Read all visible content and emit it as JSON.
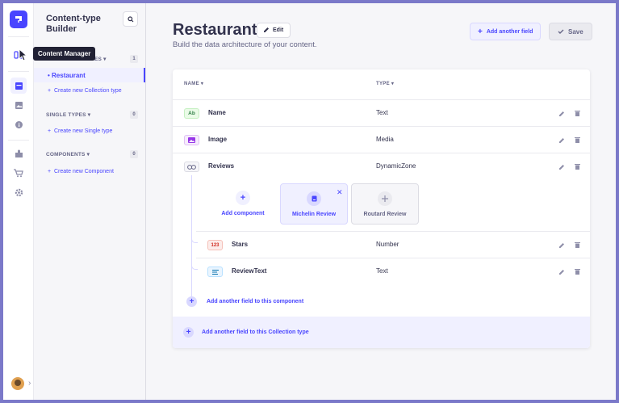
{
  "app": {
    "brand_color": "#4945ff",
    "tooltip": "Content Manager"
  },
  "sidebar": {
    "title": "Content-type Builder",
    "search_icon": "search-icon",
    "sections": [
      {
        "heading": "COLLECTION TYPES",
        "visible_heading_fragment": "ES",
        "count": "1",
        "active_item": "Restaurant",
        "create_link": "Create new Collection type"
      },
      {
        "heading": "SINGLE TYPES",
        "count": "0",
        "create_link": "Create new Single type"
      },
      {
        "heading": "COMPONENTS",
        "count": "0",
        "create_link": "Create new Component"
      }
    ]
  },
  "header": {
    "title": "Restaurant",
    "edit_label": "Edit",
    "subtitle": "Build the data architecture of your content.",
    "add_field_label": "Add another field",
    "save_label": "Save"
  },
  "table": {
    "col_name": "NAME",
    "col_type": "TYPE",
    "fields": [
      {
        "badge": "Ab",
        "name": "Name",
        "type": "Text"
      },
      {
        "badge": "img",
        "name": "Image",
        "type": "Media"
      },
      {
        "badge": "dz",
        "name": "Reviews",
        "type": "DynamicZone"
      }
    ],
    "components": [
      {
        "label": "Add component",
        "icon": "plus-icon"
      },
      {
        "label": "Michelin Review",
        "icon": "component-icon"
      },
      {
        "label": "Routard Review",
        "icon": "component-icon"
      }
    ],
    "sub_fields": [
      {
        "badge": "123",
        "name": "Stars",
        "type": "Number"
      },
      {
        "badge": "txt",
        "name": "ReviewText",
        "type": "Text"
      }
    ],
    "add_component_field": "Add another field to this component",
    "add_collection_field": "Add another field to this Collection type"
  }
}
